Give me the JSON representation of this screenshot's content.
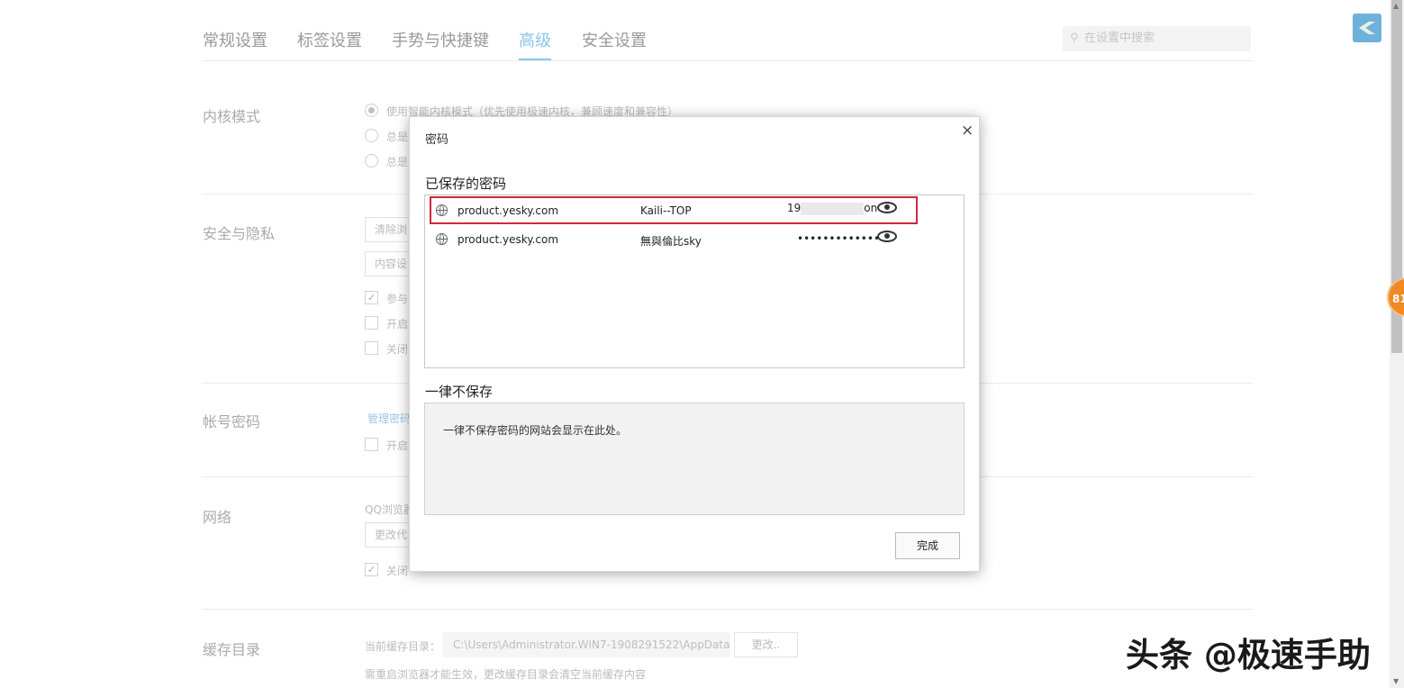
{
  "tabs": [
    {
      "label": "常规设置",
      "active": false
    },
    {
      "label": "标签设置",
      "active": false
    },
    {
      "label": "手势与快捷键",
      "active": false
    },
    {
      "label": "高级",
      "active": true
    },
    {
      "label": "安全设置",
      "active": false
    }
  ],
  "search": {
    "placeholder": "在设置中搜索"
  },
  "sections": {
    "kernel": {
      "label": "内核模式",
      "option1": "使用智能内核模式（优先使用极速内核，兼顾速度和兼容性）",
      "option2": "总是",
      "option3": "总是"
    },
    "security": {
      "label": "安全与隐私",
      "btn1": "清除浏",
      "btn2": "内容设",
      "cb1": "参与",
      "cb2": "开启",
      "cb3": "关闭"
    },
    "account": {
      "label": "帐号密码",
      "link": "管理密码",
      "cb1": "开启"
    },
    "network": {
      "label": "网络",
      "desc": "QQ浏览器",
      "btn": "更改代",
      "cb1": "关闭"
    },
    "cache": {
      "label": "缓存目录",
      "current_label": "当前缓存目录：",
      "path": "C:\\Users\\Administrator.WIN7-1908291522\\AppData",
      "change_btn": "更改..",
      "note": "需重启浏览器才能生效，更改缓存目录会清空当前缓存内容"
    }
  },
  "badge": {
    "text": "81"
  },
  "dialog": {
    "title": "密码",
    "close": "×",
    "saved_heading": "已保存的密码",
    "saved": [
      {
        "site": "product.yesky.com",
        "user": "Kaili--TOP",
        "pass_prefix": "19",
        "pass_suffix": "on",
        "highlighted": true
      },
      {
        "site": "product.yesky.com",
        "user": "無與倫比sky",
        "pass": "•••••••••••••",
        "highlighted": false
      }
    ],
    "never_heading": "一律不保存",
    "never_text": "一律不保存密码的网站会显示在此处。",
    "done": "完成"
  },
  "watermark": "头条 @极速手助",
  "colors": {
    "accent": "#8cc6ea",
    "highlight": "#d0283a",
    "badge": "#f08a24"
  }
}
